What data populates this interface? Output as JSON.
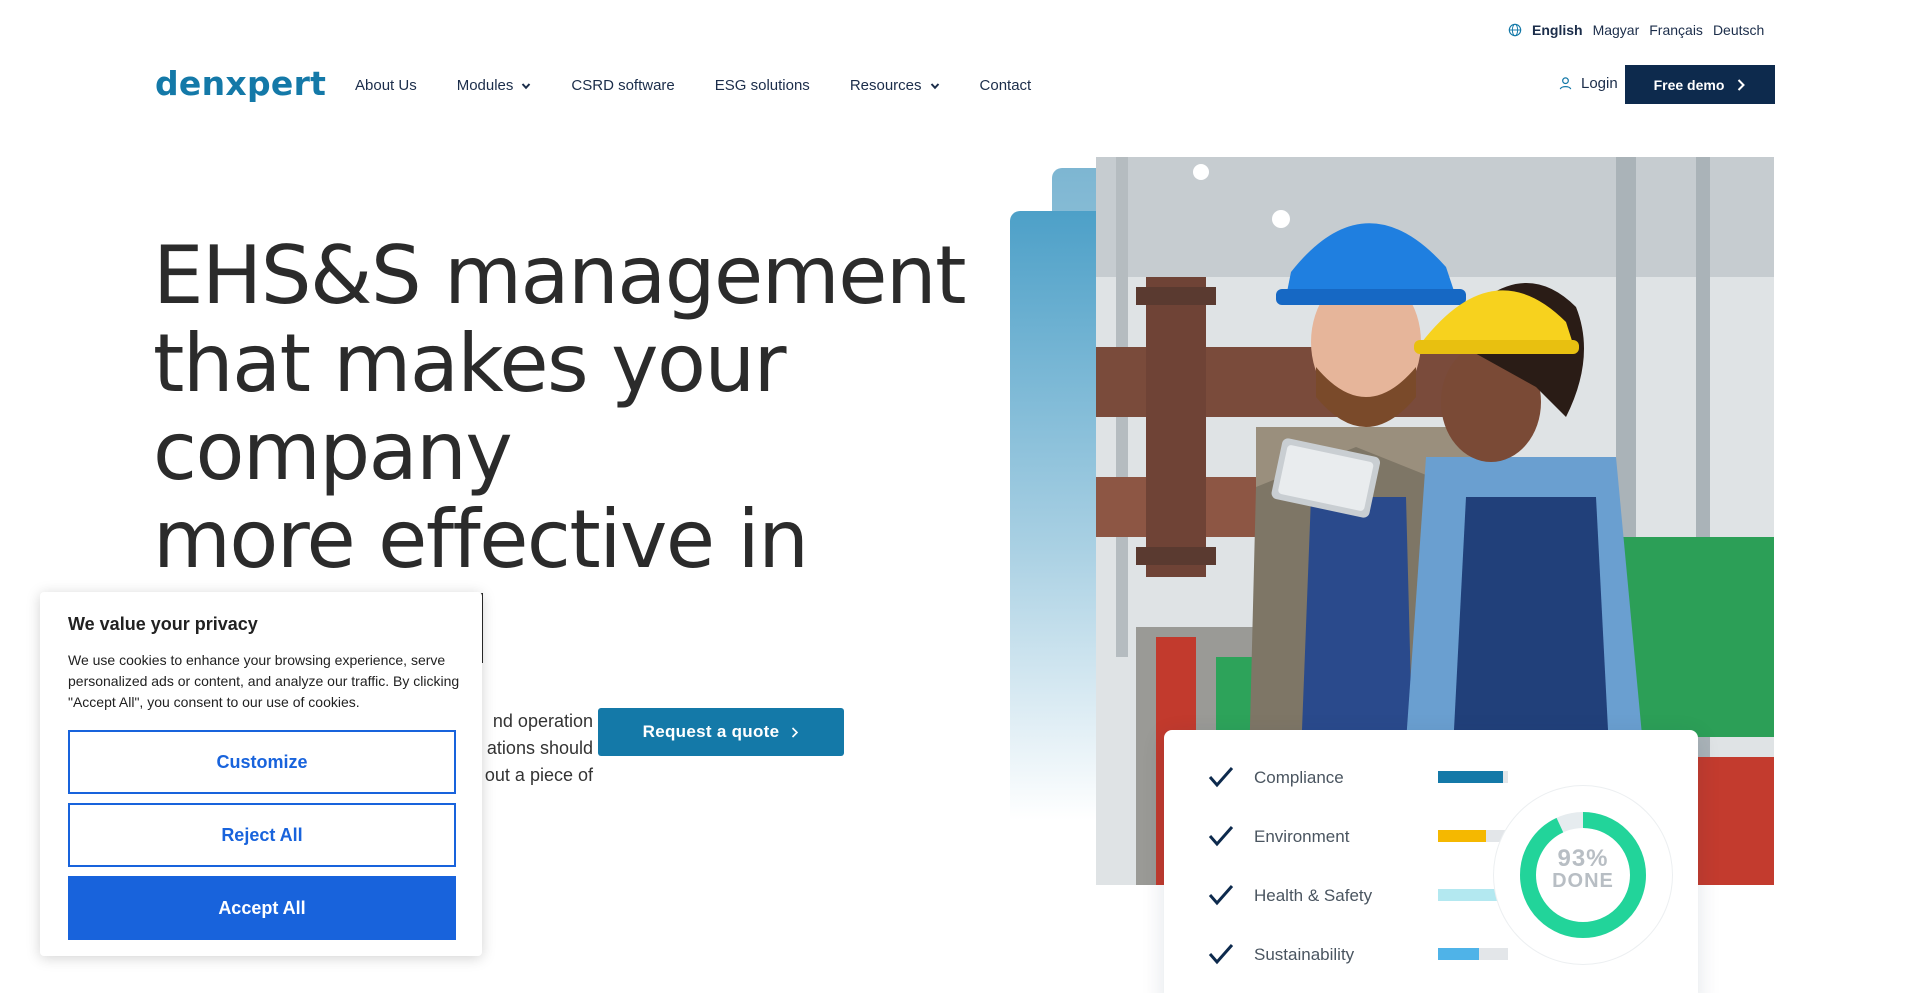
{
  "languages": {
    "items": [
      {
        "label": "English",
        "active": true
      },
      {
        "label": "Magyar",
        "active": false
      },
      {
        "label": "Français",
        "active": false
      },
      {
        "label": "Deutsch",
        "active": false
      }
    ]
  },
  "header": {
    "logo": "denxpert",
    "nav": [
      {
        "label": "About Us",
        "has_dropdown": false
      },
      {
        "label": "Modules",
        "has_dropdown": true
      },
      {
        "label": "CSRD software",
        "has_dropdown": false
      },
      {
        "label": "ESG solutions",
        "has_dropdown": false
      },
      {
        "label": "Resources",
        "has_dropdown": true
      },
      {
        "label": "Contact",
        "has_dropdown": false
      }
    ],
    "login_label": "Login",
    "demo_label": "Free demo"
  },
  "hero": {
    "title_lines": [
      "EHS&S management",
      "that makes your",
      "company",
      "more effective in"
    ],
    "text_lines_visible": [
      "nd operation",
      "ations should",
      "out a piece of"
    ],
    "quote_label": "Request a quote"
  },
  "progress_card": {
    "items": [
      {
        "label": "Compliance",
        "progress": 0.93,
        "color": "#1479a8"
      },
      {
        "label": "Environment",
        "progress": 0.68,
        "color": "#f5b800"
      },
      {
        "label": "Health & Safety",
        "progress": 1.0,
        "color": "#b3e8f0"
      },
      {
        "label": "Sustainability",
        "progress": 0.58,
        "color": "#4fb3e8"
      }
    ],
    "donut": {
      "percent_label": "93%",
      "done_label": "DONE",
      "value": 0.93,
      "color": "#22d49a"
    }
  },
  "cookie": {
    "title": "We value your privacy",
    "body": "We use cookies to enhance your browsing experience, serve personalized ads or content, and analyze our traffic. By clicking \"Accept All\", you consent to our use of cookies.",
    "customize_label": "Customize",
    "reject_label": "Reject All",
    "accept_label": "Accept All"
  },
  "colors": {
    "brand": "#1479a8",
    "navy": "#0d2a4d",
    "cookie_blue": "#1863dc"
  }
}
